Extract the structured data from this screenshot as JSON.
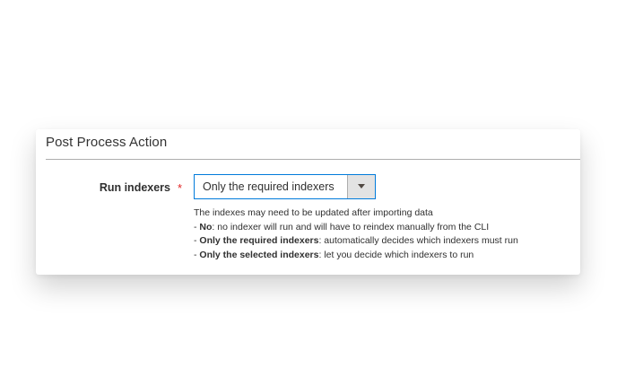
{
  "section": {
    "title": "Post Process Action"
  },
  "field": {
    "label": "Run indexers",
    "required_mark": "*",
    "selected_value": "Only the required indexers"
  },
  "note": {
    "intro": "The indexes may need to be updated after importing data",
    "options": [
      {
        "prefix": "- ",
        "name": "No",
        "description": ": no indexer will run and will have to reindex manually from the CLI"
      },
      {
        "prefix": "- ",
        "name": "Only the required indexers",
        "description": ": automatically decides which indexers must run"
      },
      {
        "prefix": "- ",
        "name": "Only the selected indexers",
        "description": ": let you decide which indexers to run"
      }
    ]
  },
  "colors": {
    "focus_border": "#007bdb",
    "required": "#e22626",
    "arrow_bg": "#e3e3e3"
  },
  "icons": {
    "dropdown": "triangle-down-icon"
  }
}
